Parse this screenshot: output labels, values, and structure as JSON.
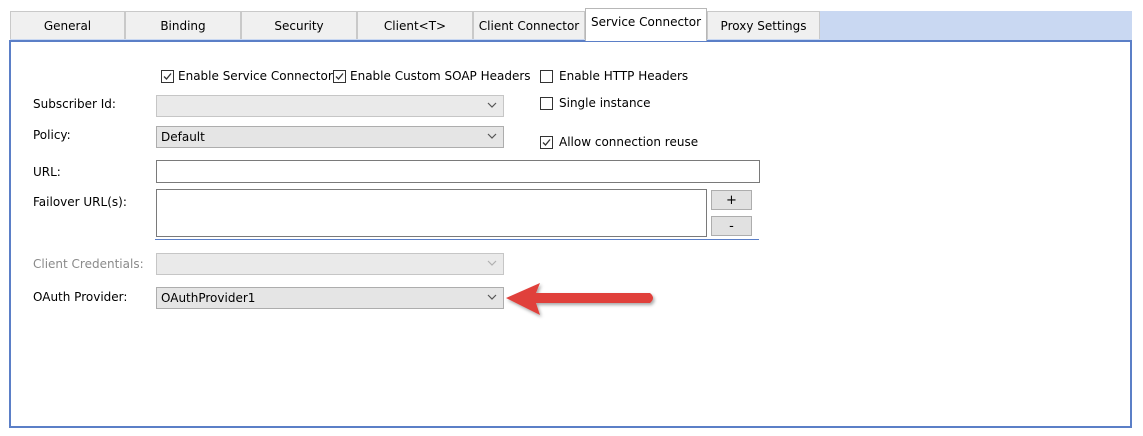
{
  "tabs": [
    {
      "label": "General"
    },
    {
      "label": "Binding"
    },
    {
      "label": "Security"
    },
    {
      "label": "Client<T>"
    },
    {
      "label": "Client Connector"
    },
    {
      "label": "Service Connector"
    },
    {
      "label": "Proxy Settings"
    }
  ],
  "active_tab": "Service Connector",
  "checkboxes": {
    "enable_service_connector": {
      "label": "Enable Service Connector",
      "checked": true
    },
    "enable_custom_soap_headers": {
      "label": "Enable Custom SOAP Headers",
      "checked": true
    },
    "enable_http_headers": {
      "label": "Enable HTTP Headers",
      "checked": false
    },
    "single_instance": {
      "label": "Single instance",
      "checked": false
    },
    "allow_connection_reuse": {
      "label": "Allow connection reuse",
      "checked": true
    }
  },
  "form": {
    "subscriber_id": {
      "label": "Subscriber Id:",
      "value": ""
    },
    "policy": {
      "label": "Policy:",
      "value": "Default"
    },
    "url": {
      "label": "URL:",
      "value": ""
    },
    "failover_urls": {
      "label": "Failover URL(s):",
      "value": "",
      "add_label": "+",
      "remove_label": "-"
    },
    "client_credentials": {
      "label": "Client Credentials:",
      "value": ""
    },
    "oauth_provider": {
      "label": "OAuth Provider:",
      "value": "OAuthProvider1"
    }
  },
  "colors": {
    "accent": "#5b7fc7",
    "tab_strip": "#c9d8f2",
    "arrow": "#e0413b"
  }
}
